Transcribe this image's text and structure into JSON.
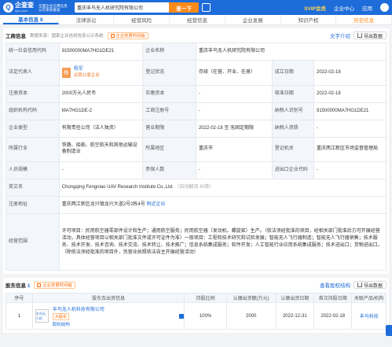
{
  "header": {
    "logo_text": "企查查",
    "logo_domain": "Qcc.com",
    "promo": "全国企业信用信息公示系统备案",
    "search_value": "重庆丰鸟无人机研究院有限公司",
    "search_button": "查一下",
    "nav": [
      "SVIP会员",
      "企业中心",
      "应用",
      "应用"
    ],
    "vip": "SVIP会员",
    "nav_company": "企业中心",
    "nav_apps": "应用"
  },
  "tabs": [
    "基本信息 8",
    "法律诉讼",
    "经营风险",
    "经营信息",
    "企业发展",
    "知识产权",
    "历史信息"
  ],
  "basic": {
    "title": "工商信息",
    "source_note": "数据来源：国家企业信用信息公示系统",
    "chip": "企业变更时间轴",
    "translate_link": "文字介绍",
    "export_button": "导出数据",
    "credit_code_label": "统一社会信用代码",
    "credit_code": "91500000MA7HG1DE21",
    "name_label": "企业名称",
    "name": "重庆丰鸟无人机研究院有限公司",
    "legal_rep_label": "法定代表人",
    "legal_rep_avatar": "杨",
    "legal_rep_name": "杨军",
    "legal_rep_tag": "关联11家企业",
    "reg_status_label": "登记状态",
    "reg_status": "存续（在营、开业、在册）",
    "found_date_label": "成立日期",
    "found_date": "2022-02-18",
    "reg_capital_label": "注册资本",
    "reg_capital": "2000万元人民币",
    "paid_capital_label": "实缴资本",
    "paid_capital": "-",
    "approve_date_label": "核准日期",
    "approve_date": "2022-02-18",
    "org_code_label": "组织机构代码",
    "org_code": "MA7HG1DE-2",
    "biz_reg_no_label": "工商注册号",
    "biz_reg_no": "-",
    "taxpayer_id_label": "纳税人识别号",
    "taxpayer_id": "91500000MA7HG1DE21",
    "type_label": "企业类型",
    "type": "有限责任公司（法人独资）",
    "term_label": "营业期限",
    "term": "2022-02-18 至 无固定期限",
    "tax_qual_label": "纳税人资质",
    "tax_qual": "-",
    "industry_label": "所属行业",
    "industry": "铁路、船舶、航空航天和其他运输设备制造业",
    "region_label": "所属地区",
    "region": "重庆市",
    "authority_label": "登记机关",
    "authority": "重庆两江新区市场监督管理局",
    "staff_label": "人员规模",
    "staff": "-",
    "insured_label": "参保人数",
    "insured": "-",
    "ie_code_label": "进出口企业代码",
    "ie_code": "-",
    "en_name_label": "英文名",
    "en_name": "Chongqing Fengniao UAV Research Institute Co.,Ltd.",
    "en_name_note": "（自动翻译 纠错）",
    "address_label": "注册地址",
    "address": "重庆两江新区龙兴镇龙兴大道2号2栋4号",
    "address_link": "附近企业",
    "scope_label": "经营范围",
    "scope": "许可项目：民用航空器零部件设计和生产；通用航空服务；民用航空器（发动机、螺旋桨）生产。（依法须经批准的项目，经相关部门批准后方可开展经营活动，具体经营项目以相关部门批准文件或许可证件为准）一般项目：工程和技术研究和试验发展；智能无人飞行器制造；智能无人飞行器销售；技术服务、技术开发、技术咨询、技术交流、技术转让、技术推广；信息系统集成服务；软件开发；人工智能行业应用系统集成服务；技术进出口；货物进出口。（除依法须经批准的项目外，凭营业执照依法自主开展经营活动）"
  },
  "shareholders": {
    "title": "股东信息",
    "count": "1",
    "chip": "企业变更时间轴",
    "equity_link": "查看股权结构",
    "export_button": "导出数据",
    "columns": [
      "序号",
      "股东及出资信息",
      "持股比例",
      "认缴出资额(万元)",
      "认缴出资日期",
      "首次持股日期",
      "关联产品/机构"
    ],
    "rows": [
      {
        "index": "1",
        "logo": "丰鸟无人机",
        "name": "丰鸟无人机科技有限公司",
        "tag": "大股东",
        "link": "股权结构",
        "ratio": "100%",
        "amount": "2000",
        "date1": "2022-12-31",
        "date2": "2022-02-18",
        "product": "丰鸟科技"
      }
    ]
  }
}
